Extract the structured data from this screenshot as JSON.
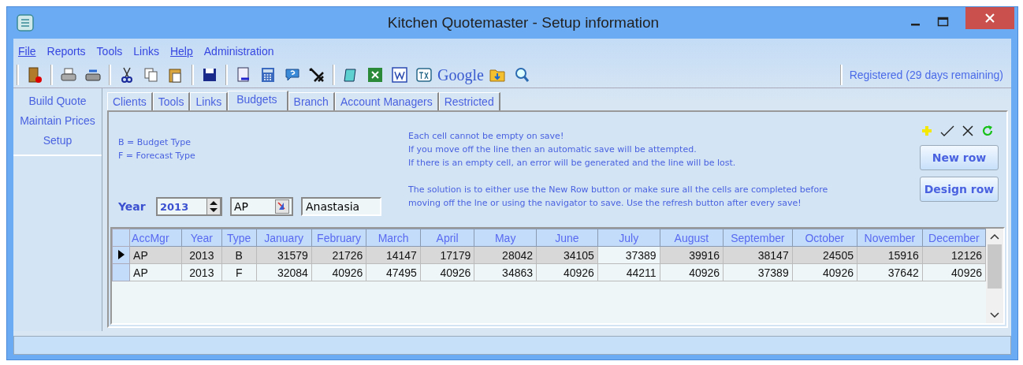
{
  "window": {
    "title": "Kitchen Quotemaster - Setup information"
  },
  "menu": [
    {
      "label": "File",
      "mnemonic": true
    },
    {
      "label": "Reports",
      "mnemonic": false
    },
    {
      "label": "Tools",
      "mnemonic": false
    },
    {
      "label": "Links",
      "mnemonic": false
    },
    {
      "label": "Help",
      "mnemonic": true
    },
    {
      "label": "Administration",
      "mnemonic": false
    }
  ],
  "toolbar": {
    "google_label": "Google",
    "registration": "Registered (29 days remaining)"
  },
  "sidebar": {
    "items": [
      "Build Quote",
      "Maintain Prices",
      "Setup"
    ]
  },
  "tabs": [
    {
      "label": "Clients",
      "selected": false
    },
    {
      "label": "Tools",
      "selected": false
    },
    {
      "label": "Links",
      "selected": false
    },
    {
      "label": "Budgets",
      "selected": true
    },
    {
      "label": "Branch",
      "selected": false
    },
    {
      "label": "Account Managers",
      "selected": false
    },
    {
      "label": "Restricted",
      "selected": false
    }
  ],
  "legend": [
    "B = Budget Type",
    "F = Forecast Type"
  ],
  "notes_rules": [
    "Each cell cannot be empty on save!",
    "If you move off the line then an automatic save will be attempted.",
    "If there is an empty cell, an error will be generated and the line will be lost."
  ],
  "notes_solution": [
    "The solution is to either use the New Row button or make sure all the cells are completed before",
    "moving off the lne or using the navigator to save. Use the refresh button after every save!"
  ],
  "filters": {
    "year_label": "Year",
    "year": "2013",
    "manager": "AP",
    "manager_name": "Anastasia"
  },
  "buttons": [
    "New row",
    "Design row"
  ],
  "table": {
    "columns": [
      "AccMgr",
      "Year",
      "Type",
      "January",
      "February",
      "March",
      "April",
      "May",
      "June",
      "July",
      "August",
      "September",
      "October",
      "November",
      "December"
    ],
    "rows": [
      {
        "selected": true,
        "cells": [
          "AP",
          "2013",
          "B",
          "31579",
          "21726",
          "14147",
          "17179",
          "28042",
          "34105",
          "37389",
          "39916",
          "38147",
          "24505",
          "15916",
          "12126"
        ]
      },
      {
        "selected": false,
        "cells": [
          "AP",
          "2013",
          "F",
          "32084",
          "40926",
          "47495",
          "40926",
          "34863",
          "40926",
          "44211",
          "40926",
          "37389",
          "40926",
          "37642",
          "40926"
        ]
      }
    ]
  }
}
